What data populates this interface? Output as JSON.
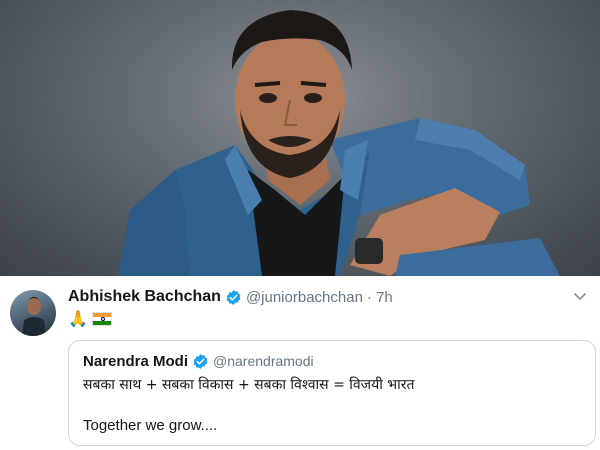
{
  "tweet": {
    "author_name": "Abhishek Bachchan",
    "author_handle": "@juniorbachchan",
    "time": "· 7h",
    "body_emoji": "🙏",
    "verified": true
  },
  "quoted_tweet": {
    "author_name": "Narendra Modi",
    "author_handle": "@narendramodi",
    "text_line_1": "सबका साथ + सबका विकास + सबका विश्वास = विजयी भारत",
    "text_line_2": "Together we grow....",
    "verified": true
  },
  "icons": {
    "verified": "verified-badge-icon",
    "menu": "chevron-down-icon",
    "flag": "india-flag-icon"
  },
  "colors": {
    "verified_blue": "#1da1f2",
    "text_primary": "#14171a",
    "text_secondary": "#657786",
    "quote_border": "#ccd6dd"
  }
}
